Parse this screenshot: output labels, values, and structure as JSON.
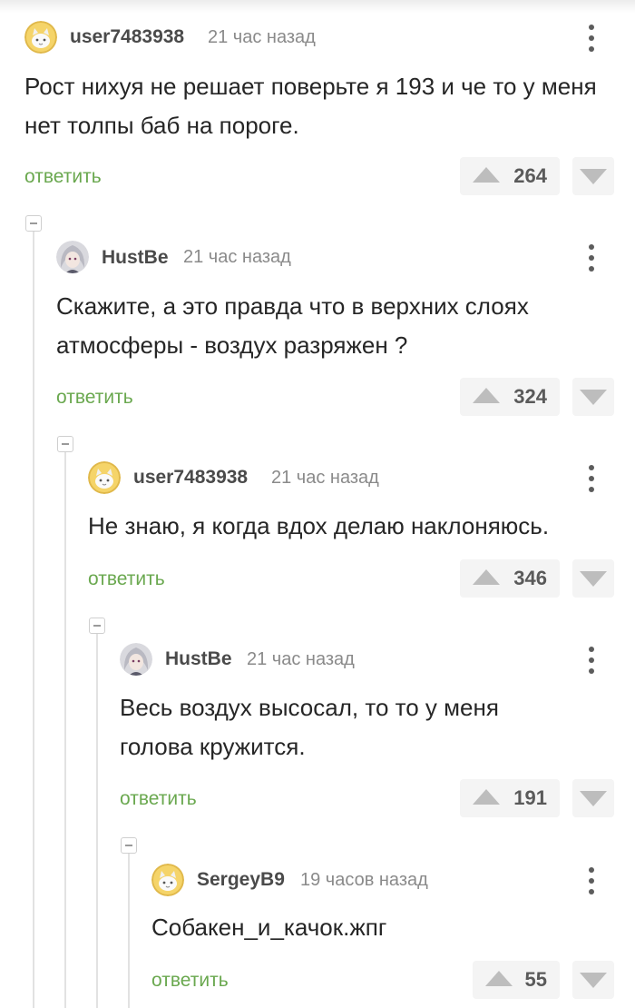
{
  "colors": {
    "reply_link": "#6aa84f",
    "username": "#4a4a4a",
    "timestamp": "#8a8a8a",
    "vote_background": "#f4f4f4",
    "vote_arrow": "#bdbdbd",
    "thread_line": "#e2e2e2"
  },
  "comments": [
    {
      "username": "user7483938",
      "timestamp": "21 час назад",
      "avatar_icon": "cat-face-avatar",
      "text": "Рост нихуя не решает поверьте я 193 и че то у меня нет толпы баб на пороге.",
      "reply_label": "ответить",
      "score": "264"
    },
    {
      "username": "HustBe",
      "timestamp": "21 час назад",
      "avatar_icon": "anime-portrait-avatar",
      "text": "Скажите, а это правда что в верхних слоях атмосферы - воздух разряжен ?",
      "reply_label": "ответить",
      "score": "324"
    },
    {
      "username": "user7483938",
      "timestamp": "21 час назад",
      "avatar_icon": "cat-face-avatar",
      "text": "Не знаю, я когда вдох делаю наклоняюсь.",
      "reply_label": "ответить",
      "score": "346"
    },
    {
      "username": "HustBe",
      "timestamp": "21 час назад",
      "avatar_icon": "anime-portrait-avatar",
      "text": "Весь воздух высосал, то то у меня голова кружится.",
      "reply_label": "ответить",
      "score": "191"
    },
    {
      "username": "SergeyB9",
      "timestamp": "19 часов назад",
      "avatar_icon": "cat-face-avatar",
      "text": "Собакен_и_качок.жпг",
      "reply_label": "ответить",
      "score": "55"
    }
  ]
}
